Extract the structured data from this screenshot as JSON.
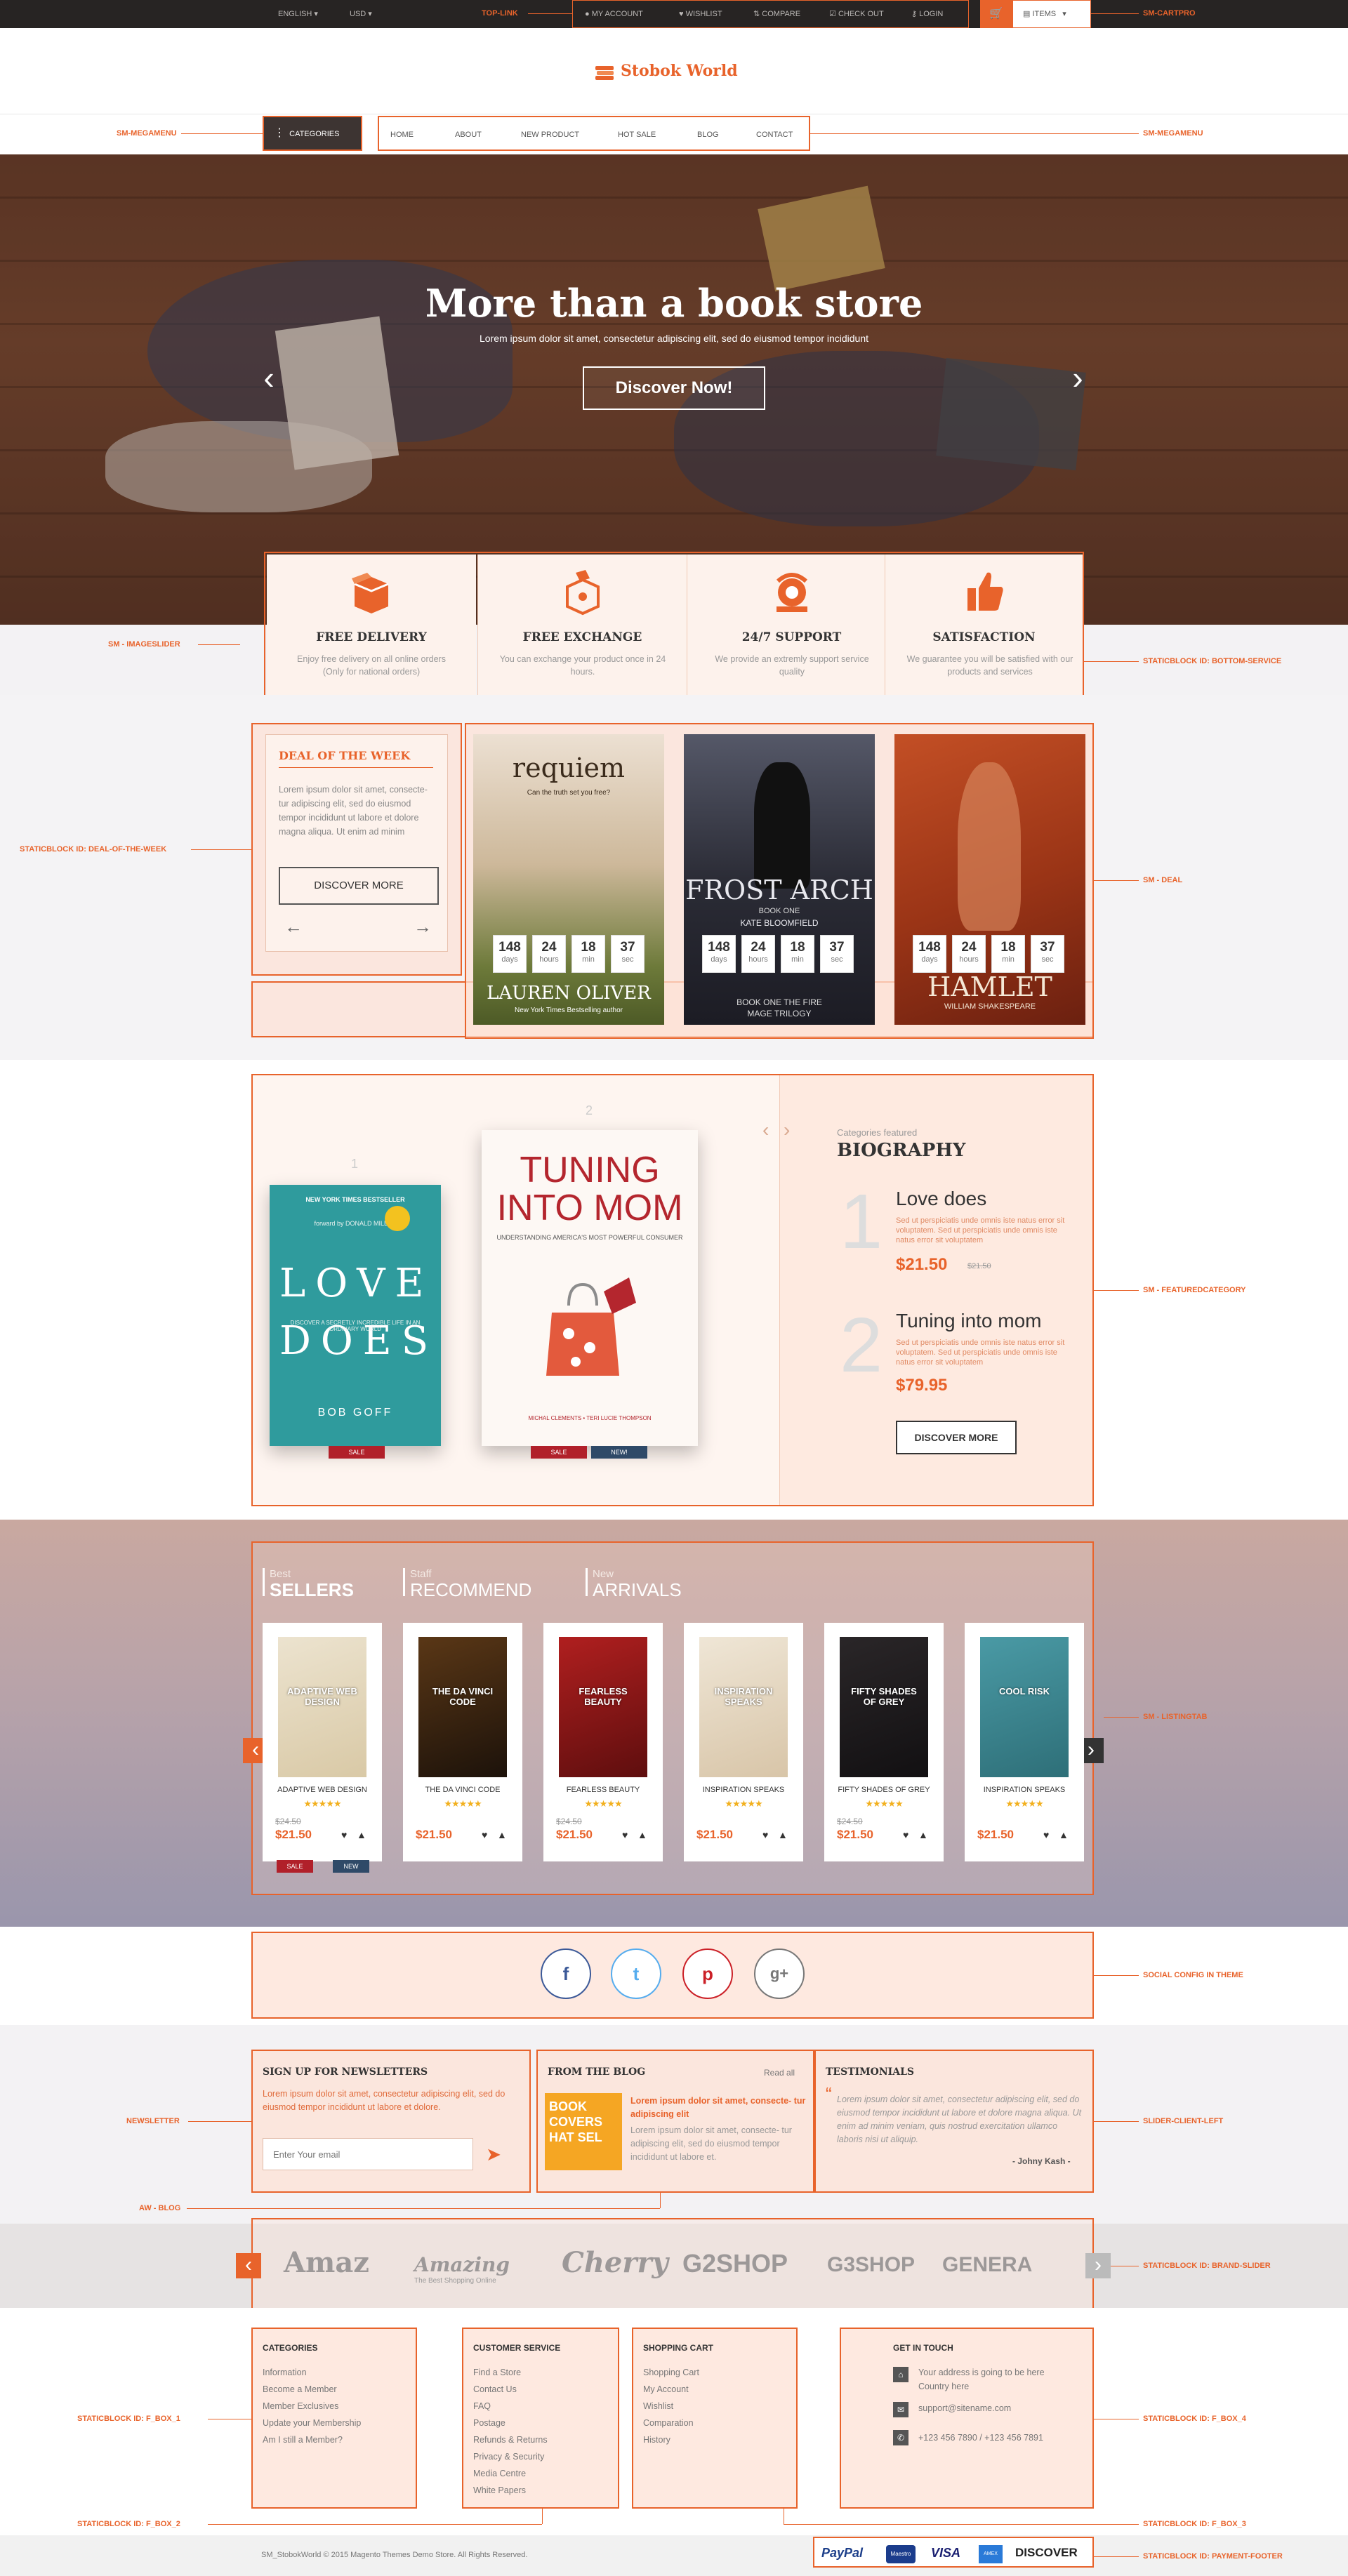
{
  "topbar": {
    "language": "ENGLISH",
    "currency": "USD",
    "links": [
      "MY ACCOUNT",
      "WISHLIST",
      "COMPARE",
      "CHECK OUT",
      "LOGIN"
    ],
    "cart_label": "ITEMS"
  },
  "header": {
    "logo_text": "Stobok World"
  },
  "nav": {
    "categories_label": "CATEGORIES",
    "links": [
      "HOME",
      "ABOUT",
      "NEW PRODUCT",
      "HOT SALE",
      "BLOG",
      "CONTACT"
    ]
  },
  "hero": {
    "title": "More than a book store",
    "subtitle": "Lorem ipsum dolor sit amet, consectetur adipiscing elit, sed do eiusmod tempor incididunt",
    "button": "Discover Now!",
    "prev": "‹",
    "next": "›"
  },
  "services": [
    {
      "icon": "box-icon",
      "title": "FREE DELIVERY",
      "text": "Enjoy free delivery on all online orders (Only for national orders)"
    },
    {
      "icon": "exchange-icon",
      "title": "FREE EXCHANGE",
      "text": "You can exchange your product once in 24 hours."
    },
    {
      "icon": "phone-icon",
      "title": "24/7 SUPPORT",
      "text": "We provide an extremly support service quality"
    },
    {
      "icon": "thumbs-up-icon",
      "title": "SATISFACTION",
      "text": "We guarantee you will be satisfied with our products and services"
    }
  ],
  "deal": {
    "title": "DEAL OF THE WEEK",
    "text": "Lorem ipsum dolor sit amet, consecte- tur adipiscing elit, sed do eiusmod tempor incididunt ut labore et dolore magna aliqua. Ut enim ad minim",
    "button": "DISCOVER MORE",
    "prev": "←",
    "next": "→",
    "books": [
      {
        "title": "requiem",
        "tagline": "Can the truth set you free?",
        "author": "LAUREN OLIVER",
        "note": "New York Times Bestselling author",
        "colors": [
          "#e9d7c4",
          "#b5a27a",
          "#5f6b34"
        ]
      },
      {
        "title": "FROST ARCH",
        "tagline": "BOOK ONE",
        "author": "KATE BLOOMFIELD",
        "note": "BOOK ONE THE FIRE MAGE TRILOGY",
        "colors": [
          "#3b3c48",
          "#1f1f27",
          "#4a4b57"
        ]
      },
      {
        "title": "HAMLET",
        "tagline": "",
        "author": "WILLIAM SHAKESPEARE",
        "note": "",
        "colors": [
          "#a53e1e",
          "#7a2a12",
          "#c0522c"
        ]
      }
    ],
    "countdown": [
      {
        "value": "148",
        "unit": "days"
      },
      {
        "value": "24",
        "unit": "hours"
      },
      {
        "value": "18",
        "unit": "min"
      },
      {
        "value": "37",
        "unit": "sec"
      }
    ]
  },
  "featured": {
    "index_1": "1",
    "index_2": "2",
    "book1": {
      "banner": "NEW YORK TIMES BESTSELLER",
      "foreword": "forward by DONALD MILLER",
      "title": "LOVE DOES",
      "desc": "DISCOVER A SECRETLY INCREDIBLE LIFE IN AN ORDINARY WORLD",
      "author": "BOB GOFF"
    },
    "book2": {
      "title": "TUNING INTO MOM",
      "subtitle": "UNDERSTANDING AMERICA'S MOST POWERFUL CONSUMER",
      "authors": "MICHAL CLEMENTS • TERI LUCIE THOMPSON"
    },
    "tags": {
      "sale": "SALE",
      "new": "NEW!"
    },
    "category_label": "Categories featured",
    "category": "BIOGRAPHY",
    "items": [
      {
        "num": "1",
        "name": "Love does",
        "text": "Sed ut perspiciatis unde omnis iste natus error sit voluptatem. Sed ut perspiciatis unde omnis iste natus error sit voluptatem",
        "price": "$21.50",
        "old": "$21.50"
      },
      {
        "num": "2",
        "name": "Tuning into mom",
        "text": "Sed ut perspiciatis unde omnis iste natus error sit voluptatem. Sed ut perspiciatis unde omnis iste natus error sit voluptatem",
        "price": "$79.95",
        "old": ""
      }
    ],
    "button": "DISCOVER MORE"
  },
  "listing": {
    "tabs": [
      {
        "small": "Best",
        "big": "SELLERS"
      },
      {
        "small": "Staff",
        "big": "RECOMMEND"
      },
      {
        "small": "New",
        "big": "ARRIVALS"
      }
    ],
    "stars": "★★★★★",
    "prev": "‹",
    "next": "›",
    "products": [
      {
        "name": "ADAPTIVE WEB DESIGN",
        "old": "$24.50",
        "price": "$21.50",
        "cover": [
          "#ece3cf",
          "#d9c9a6"
        ],
        "cover_title": "ADAPTIVE WEB DESIGN",
        "tags": [
          "SALE",
          "NEW"
        ]
      },
      {
        "name": "THE DA VINCI CODE",
        "old": "",
        "price": "$21.50",
        "cover": [
          "#5a3716",
          "#1c120a"
        ],
        "cover_title": "THE DA VINCI CODE",
        "tags": []
      },
      {
        "name": "FEARLESS BEAUTY",
        "old": "$24.50",
        "price": "$21.50",
        "cover": [
          "#b01f1f",
          "#5e0e0e"
        ],
        "cover_title": "FEARLESS BEAUTY",
        "tags": []
      },
      {
        "name": "INSPIRATION SPEAKS",
        "old": "",
        "price": "$21.50",
        "cover": [
          "#efe6d6",
          "#d8c5a8"
        ],
        "cover_title": "INSPIRATION SPEAKS",
        "tags": []
      },
      {
        "name": "FIFTY SHADES OF GREY",
        "old": "$24.50",
        "price": "$21.50",
        "cover": [
          "#2a2628",
          "#121012"
        ],
        "cover_title": "FIFTY SHADES OF GREY",
        "tags": []
      },
      {
        "name": "INSPIRATION SPEAKS",
        "old": "",
        "price": "$21.50",
        "cover": [
          "#4a9aa5",
          "#2e6f78"
        ],
        "cover_title": "COOL RISK",
        "tags": []
      }
    ]
  },
  "social": [
    {
      "icon": "facebook-icon",
      "glyph": "f",
      "color": "#3b5998"
    },
    {
      "icon": "twitter-icon",
      "glyph": "t",
      "color": "#55acee"
    },
    {
      "icon": "pinterest-icon",
      "glyph": "p",
      "color": "#cb2027"
    },
    {
      "icon": "google-plus-icon",
      "glyph": "g+",
      "color": "#777777"
    }
  ],
  "newsletter": {
    "title": "SIGN UP FOR NEWSLETTERS",
    "text": "Lorem ipsum dolor sit amet, consectetur adipiscing elit, sed do eiusmod tempor incididunt ut labore et dolore.",
    "placeholder": "Enter Your email"
  },
  "blog": {
    "title": "FROM THE BLOG",
    "read_all": "Read all",
    "cover_text": "BOOK COVERS HAT SEL",
    "headline": "Lorem ipsum dolor sit amet, consecte- tur adipiscing elit",
    "text": "Lorem ipsum dolor sit amet, consecte- tur adipiscing elit, sed do eiusmod tempor incididunt ut labore et."
  },
  "testimonials": {
    "title": "TESTIMONIALS",
    "quote": "Lorem ipsum dolor sit amet, consectetur adipiscing elit, sed do eiusmod tempor incididunt ut labore et dolore magna aliqua. Ut enim ad minim veniam, quis nostrud exercitation ullamco laboris nisi ut aliquip.",
    "author": "- Johny Kash -"
  },
  "brands": {
    "items": [
      "Amaz",
      "Amazing",
      "Cherry",
      "G2SHOP",
      "G3SHOP",
      "GENERA"
    ],
    "amazing_sub": "The Best Shopping Online",
    "prev": "‹",
    "next": "›"
  },
  "footer": {
    "columns": [
      {
        "title": "CATEGORIES",
        "links": [
          "Information",
          "Become a Member",
          "Member Exclusives",
          "Update your Membership",
          "Am I still a Member?"
        ]
      },
      {
        "title": "CUSTOMER SERVICE",
        "links": [
          "Find a Store",
          "Contact Us",
          "FAQ",
          "Postage",
          "Refunds & Returns",
          "Privacy & Security",
          "Media Centre",
          "White Papers"
        ]
      },
      {
        "title": "SHOPPING CART",
        "links": [
          "Shopping Cart",
          "My Account",
          "Wishlist",
          "Comparation",
          "History"
        ]
      }
    ],
    "contact": {
      "title": "GET IN TOUCH",
      "address": "Your address is going to be here Country here",
      "email": "support@sitename.com",
      "phone": "+123 456 7890 / +123 456 7891"
    },
    "copyright": "SM_StobokWorld © 2015 Magento Themes Demo Store. All Rights Reserved.",
    "payments": [
      "PayPal",
      "Maestro",
      "VISA",
      "AMEX",
      "DISCOVER"
    ]
  },
  "annotations": {
    "top_link": "TOP-LINK",
    "cartpro": "SM-CARTPRO",
    "megamenu_left": "SM-MEGAMENU",
    "megamenu_right": "SM-MEGAMENU",
    "imageslider": "SM - IMAGESLIDER",
    "bottom_service": "STATICBLOCK ID: BOTTOM-SERVICE",
    "deal_of_week": "STATICBLOCK ID: DEAL-OF-THE-WEEK",
    "sm_deal": "SM - DEAL",
    "featured": "SM - FEATUREDCATEGORY",
    "listingtab": "SM - LISTINGTAB",
    "social": "SOCIAL CONFIG IN THEME",
    "newsletter": "NEWSLETTER",
    "slider_client": "SLIDER-CLIENT-LEFT",
    "aw_blog": "AW - BLOG",
    "brand_slider": "STATICBLOCK ID: BRAND-SLIDER",
    "fbox1": "STATICBLOCK ID: F_BOX_1",
    "fbox2": "STATICBLOCK ID: F_BOX_2",
    "fbox3": "STATICBLOCK ID: F_BOX_3",
    "fbox4": "STATICBLOCK ID: F_BOX_4",
    "payment_footer": "STATICBLOCK ID: PAYMENT-FOOTER"
  },
  "colors": {
    "accent": "#e8632b",
    "dark": "#272423",
    "panel": "#fde2d6"
  }
}
